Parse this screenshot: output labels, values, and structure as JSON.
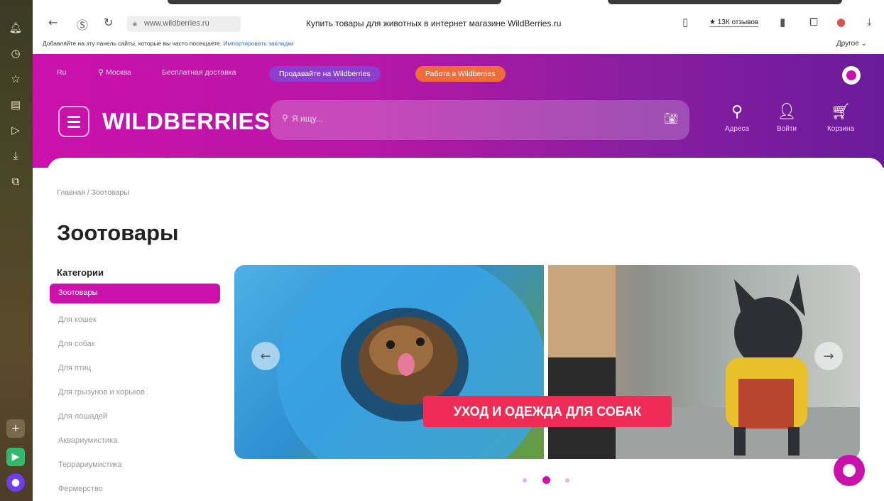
{
  "browser": {
    "address": "www.wildberries.ru",
    "tab_title": "Купить товары для животных в интернет магазине WildBerries.ru",
    "reviews": "★ 13К отзывов",
    "bookmarks_hint": "Добавляйте на эту панель сайты, которые вы часто посещаете.",
    "bookmarks_link": "Импортировать закладки",
    "other_bookmarks": "Другое ⌄",
    "icons": [
      "back-icon",
      "reload-icon",
      "lock-icon",
      "bookmark-icon",
      "download-icon"
    ]
  },
  "header": {
    "currency": "Ru",
    "city": "Москва",
    "delivery": "Бесплатная доставка",
    "sell_label": "Продавайте на Wildberries",
    "work_label": "Работа в Wildberries",
    "logo": "WILDBERRIES",
    "search_placeholder": "Я ищу...",
    "addresses": "Адреса",
    "login": "Войти",
    "cart": "Корзина"
  },
  "page": {
    "breadcrumb": "Главная  /  Зоотовары",
    "title": "Зоотовары",
    "categories_title": "Категории",
    "categories": [
      "Зоотовары",
      "Для кошек",
      "Для собак",
      "Для птиц",
      "Для грызунов и хорьков",
      "Для лошадей",
      "Аквариумистика",
      "Террариумистика",
      "Фермерство"
    ]
  },
  "banner": {
    "promo_text": "УХОД И ОДЕЖДА ДЛЯ СОБАК",
    "active_slide": 2,
    "slide_count": 3
  },
  "colors": {
    "brand": "#cb11ab",
    "brand_dark": "#6a1b9a",
    "promo": "#f02c56"
  }
}
